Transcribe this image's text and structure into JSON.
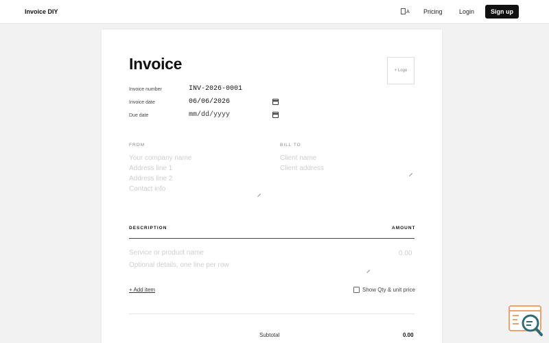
{
  "nav": {
    "brand": "Invoice DIY",
    "lang_icon": "translate-icon",
    "lang_letter": "A",
    "pricing": "Pricing",
    "login": "Login",
    "signup": "Sign up"
  },
  "invoice": {
    "title": "Invoice",
    "logo_label": "+ Logo",
    "meta": {
      "number_label": "Invoice number",
      "number_value": "INV-2026-0001",
      "date_label": "Invoice date",
      "date_value": "06/06/2026",
      "due_label": "Due date",
      "due_placeholder": "mm/dd/yyyy"
    },
    "from": {
      "label": "FROM",
      "placeholder_lines": [
        "Your company name",
        "Address line 1",
        "Address line 2",
        "Contact info"
      ]
    },
    "bill_to": {
      "label": "BILL TO",
      "placeholder_lines": [
        "Client name",
        "Client address"
      ]
    },
    "table": {
      "col_description": "DESCRIPTION",
      "col_amount": "AMOUNT",
      "item_name_placeholder": "Service or product name",
      "item_details_placeholder": "Optional details, one line per row",
      "item_amount_placeholder": "0.00"
    },
    "add_item": "+ Add item",
    "show_qty_label": "Show Qty & unit price",
    "show_qty_checked": false,
    "subtotal_label": "Subtotal",
    "subtotal_value": "0.00"
  },
  "colors": {
    "accent": "#111111",
    "widget_orange": "#f0a06a",
    "widget_teal": "#2e6b74"
  }
}
